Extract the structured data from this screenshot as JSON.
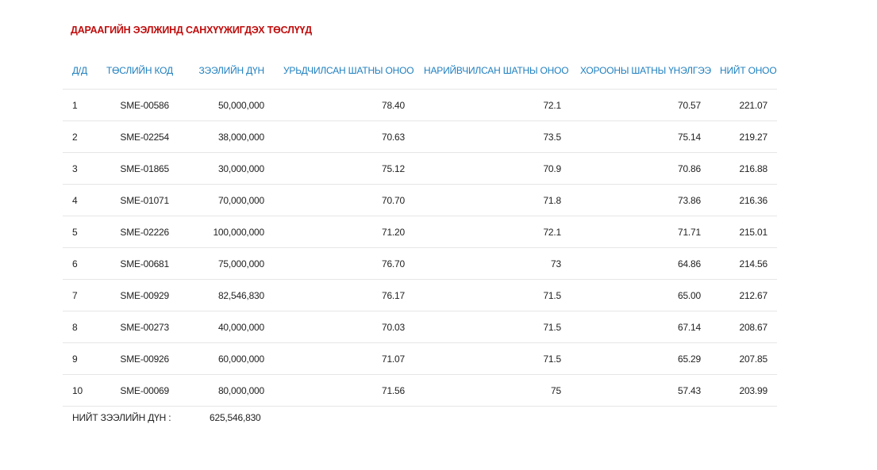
{
  "title": "ДАРААГИЙН ЭЭЛЖИНД САНХҮҮЖИГДЭХ ТӨСЛҮҮД",
  "table": {
    "headers": {
      "index": "Д/Д",
      "code": "ТӨСЛИЙН КОД",
      "loan": "ЗЭЭЛИЙН ДҮН",
      "prelim": "УРЬДЧИЛСАН ШАТНЫ ОНОО",
      "detailed": "НАРИЙВЧИЛСАН ШАТНЫ ОНОО",
      "committee": "ХОРООНЫ ШАТНЫ ҮНЭЛГЭЭ",
      "total": "НИЙТ ОНОО"
    },
    "rows": [
      {
        "index": "1",
        "code": "SME-00586",
        "loan": "50,000,000",
        "prelim": "78.40",
        "detailed": "72.1",
        "committee": "70.57",
        "total": "221.07"
      },
      {
        "index": "2",
        "code": "SME-02254",
        "loan": "38,000,000",
        "prelim": "70.63",
        "detailed": "73.5",
        "committee": "75.14",
        "total": "219.27"
      },
      {
        "index": "3",
        "code": "SME-01865",
        "loan": "30,000,000",
        "prelim": "75.12",
        "detailed": "70.9",
        "committee": "70.86",
        "total": "216.88"
      },
      {
        "index": "4",
        "code": "SME-01071",
        "loan": "70,000,000",
        "prelim": "70.70",
        "detailed": "71.8",
        "committee": "73.86",
        "total": "216.36"
      },
      {
        "index": "5",
        "code": "SME-02226",
        "loan": "100,000,000",
        "prelim": "71.20",
        "detailed": "72.1",
        "committee": "71.71",
        "total": "215.01"
      },
      {
        "index": "6",
        "code": "SME-00681",
        "loan": "75,000,000",
        "prelim": "76.70",
        "detailed": "73",
        "committee": "64.86",
        "total": "214.56"
      },
      {
        "index": "7",
        "code": "SME-00929",
        "loan": "82,546,830",
        "prelim": "76.17",
        "detailed": "71.5",
        "committee": "65.00",
        "total": "212.67"
      },
      {
        "index": "8",
        "code": "SME-00273",
        "loan": "40,000,000",
        "prelim": "70.03",
        "detailed": "71.5",
        "committee": "67.14",
        "total": "208.67"
      },
      {
        "index": "9",
        "code": "SME-00926",
        "loan": "60,000,000",
        "prelim": "71.07",
        "detailed": "71.5",
        "committee": "65.29",
        "total": "207.85"
      },
      {
        "index": "10",
        "code": "SME-00069",
        "loan": "80,000,000",
        "prelim": "71.56",
        "detailed": "75",
        "committee": "57.43",
        "total": "203.99"
      }
    ]
  },
  "summary": {
    "label": "НИЙТ ЗЭЭЛИЙН ДҮН :",
    "value": "625,546,830"
  }
}
